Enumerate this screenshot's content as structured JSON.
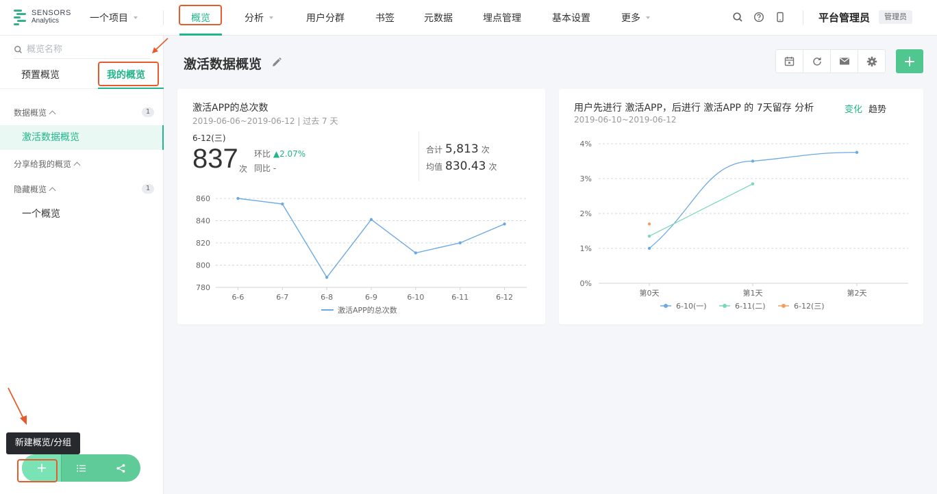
{
  "app": {
    "logo_line1": "SENSORS",
    "logo_line2": "Analytics",
    "project": "一个项目",
    "nav": [
      "概览",
      "分析",
      "用户分群",
      "书签",
      "元数据",
      "埋点管理",
      "基本设置",
      "更多"
    ],
    "user": "平台管理员",
    "role": "管理员"
  },
  "sidebar": {
    "search_placeholder": "概览名称",
    "tabs": [
      "预置概览",
      "我的概览"
    ],
    "groups": [
      {
        "label": "数据概览",
        "count": "1"
      },
      {
        "label": "分享给我的概览",
        "count": ""
      },
      {
        "label": "隐藏概览",
        "count": "1"
      }
    ],
    "items": [
      "激活数据概览",
      "一个概览"
    ],
    "tooltip": "新建概览/分组"
  },
  "main": {
    "title": "激活数据概览"
  },
  "card1": {
    "title": "激活APP的总次数",
    "subtitle": "2019-06-06~2019-06-12 | 过去 7 天",
    "date_label": "6-12(三)",
    "value": "837",
    "unit": "次",
    "hb_label": "环比",
    "hb_value": "▲2.07%",
    "tb_label": "同比 -",
    "total_label": "合计",
    "total_value": "5,813",
    "avg_label": "均值",
    "avg_value": "830.43",
    "unit2": "次"
  },
  "card2": {
    "title": "用户先进行 激活APP，后进行 激活APP 的 7天留存 分析",
    "subtitle": "2019-06-10~2019-06-12",
    "seg_change": "变化",
    "seg_trend": "趋势"
  },
  "chart_data": [
    {
      "type": "line",
      "categories": [
        "6-6",
        "6-7",
        "6-8",
        "6-9",
        "6-10",
        "6-11",
        "6-12"
      ],
      "series": [
        {
          "name": "激活APP的总次数",
          "values": [
            860,
            855,
            789,
            841,
            811,
            820,
            837
          ]
        }
      ],
      "ylim": [
        780,
        860
      ],
      "yticks": [
        780,
        800,
        820,
        840,
        860
      ],
      "color": "#6aa9e3",
      "grid": true,
      "legend": "bottom"
    },
    {
      "type": "line",
      "categories": [
        "第0天",
        "第1天",
        "第2天"
      ],
      "series": [
        {
          "name": "6-10(一)",
          "values": [
            1.0,
            3.5,
            3.75
          ],
          "color": "#6aa9e3"
        },
        {
          "name": "6-11(二)",
          "values": [
            1.35,
            2.85,
            null
          ],
          "color": "#79d8b4"
        },
        {
          "name": "6-12(三)",
          "values": [
            1.7,
            null,
            null
          ],
          "color": "#f0a066"
        }
      ],
      "ylim": [
        0,
        4
      ],
      "yticks": [
        "0%",
        "1%",
        "2%",
        "3%",
        "4%"
      ],
      "grid": true,
      "legend": "bottom"
    }
  ]
}
